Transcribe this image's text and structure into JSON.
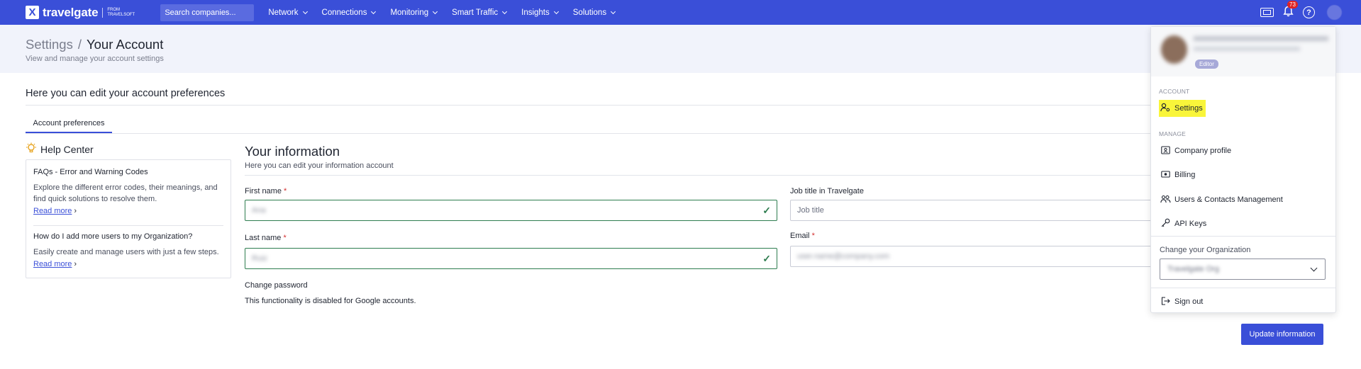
{
  "topbar": {
    "logo_mark": "X",
    "logo_word": "travelgate",
    "logo_from": "FROM TRAVELSOFT",
    "search_placeholder": "Search companies...",
    "nav": [
      "Network",
      "Connections",
      "Monitoring",
      "Smart Traffic",
      "Insights",
      "Solutions"
    ],
    "notifications_count": "73",
    "help_symbol": "?",
    "icons": [
      "ticket-icon",
      "bell-icon",
      "help-icon",
      "avatar"
    ]
  },
  "page": {
    "breadcrumb_parent": "Settings",
    "breadcrumb_sep": "/",
    "breadcrumb_current": "Your Account",
    "subtitle": "View and manage your account settings",
    "section_title": "Here you can edit your account preferences",
    "tab": "Account preferences"
  },
  "help_center": {
    "title": "Help Center",
    "items": [
      {
        "question": "FAQs - Error and Warning Codes",
        "description": "Explore the different error codes, their meanings, and find quick solutions to resolve them.",
        "link": "Read more"
      },
      {
        "question": "How do I add more users to my Organization?",
        "description": "Easily create and manage users with just a few steps.",
        "link": "Read more"
      }
    ]
  },
  "form": {
    "title": "Your information",
    "subtitle": "Here you can edit your information account",
    "first_name_label": "First name",
    "first_name_value": "Ana",
    "last_name_label": "Last name",
    "last_name_value": "Ruiz",
    "job_title_label": "Job title in Travelgate",
    "job_title_placeholder": "Job title",
    "email_label": "Email",
    "email_value": "user.name@company.com",
    "required_mark": "*",
    "change_password_label": "Change password",
    "change_password_text": "This functionality is disabled for Google accounts.",
    "submit": "Update information"
  },
  "menu": {
    "role_badge": "Editor",
    "section_account": "ACCOUNT",
    "settings": "Settings",
    "section_manage": "MANAGE",
    "company_profile": "Company profile",
    "billing": "Billing",
    "users_contacts": "Users & Contacts Management",
    "api_keys": "API Keys",
    "change_org_label": "Change your Organization",
    "org_value": "Travelgate Org",
    "sign_out": "Sign out"
  },
  "colors": {
    "brand": "#3a4fd8",
    "valid": "#2e7d4f",
    "highlight": "#f9f53a",
    "required": "#d32f2f"
  }
}
